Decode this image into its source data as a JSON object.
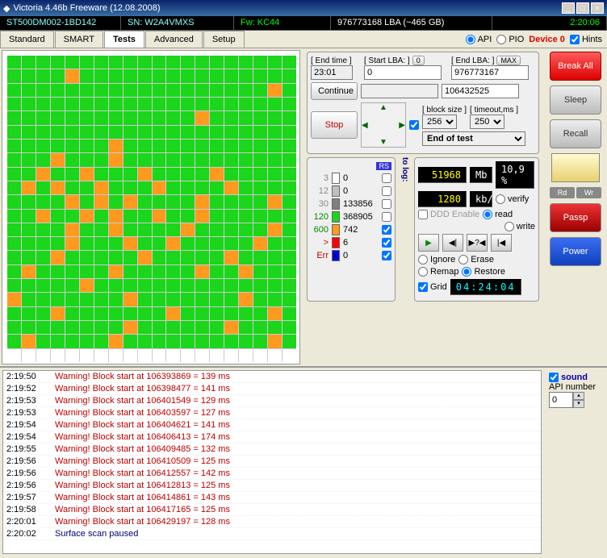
{
  "title": "Victoria 4.46b Freeware (12.08.2008)",
  "status": {
    "model": "ST500DM002-1BD142",
    "sn": "SN: W2A4VMXS",
    "fw": "Fw: KC44",
    "lba": "976773168 LBA (~465 GB)",
    "clock": "2:20:06"
  },
  "tabs": [
    "Standard",
    "SMART",
    "Tests",
    "Advanced",
    "Setup"
  ],
  "active_tab": "Tests",
  "api": {
    "api": "API",
    "pio": "PIO",
    "device": "Device 0",
    "hints": "Hints"
  },
  "scan": {
    "endtime_lbl": "[ End time ]",
    "endtime": "23:01",
    "startlba_lbl": "[ Start LBA: ]",
    "start_btn": "0",
    "startlba": "0",
    "endlba_lbl": "[ End LBA: ]",
    "max_btn": "MAX",
    "endlba": "976773167",
    "current": "106432525",
    "continue": "Continue",
    "stop": "Stop",
    "blocksize_lbl": "[ block size ]",
    "blocksize": "256",
    "timeout_lbl": "[ timeout,ms ]",
    "timeout": "250",
    "endtest": "End of test"
  },
  "legend": [
    {
      "c": "#ffffff",
      "t": "3",
      "v": "0"
    },
    {
      "c": "#c0c0c0",
      "t": "12",
      "v": "0"
    },
    {
      "c": "#808080",
      "t": "30",
      "v": "133856"
    },
    {
      "c": "#1bd61b",
      "t": "120",
      "v": "368905"
    },
    {
      "c": "#ff9a1f",
      "t": "600",
      "v": "742"
    },
    {
      "c": "#ff0000",
      "t": ">",
      "v": "6"
    },
    {
      "c": "#0000ff",
      "t": "Err",
      "v": "0",
      "x": "x"
    }
  ],
  "rs": "RS",
  "tolog": "to log:",
  "stats": {
    "num": "51968",
    "unit": "Mb",
    "pct": "10,9 %",
    "speed": "1280",
    "sunit": "kb/s",
    "ddd": "DDD Enable",
    "verify": "verify",
    "read": "read",
    "write": "write"
  },
  "play": {
    "play": "▶",
    "back": "◀|",
    "seek": "▶?◀",
    "end": "|◀"
  },
  "modes": {
    "ignore": "Ignore",
    "erase": "Erase",
    "remap": "Remap",
    "restore": "Restore"
  },
  "grid": "Grid",
  "timer": "04:24:04",
  "right": {
    "break": "Break All",
    "sleep": "Sleep",
    "recall": "Recall",
    "rd": "Rd",
    "wr": "Wr",
    "passp": "Passp",
    "power": "Power"
  },
  "sound": "sound",
  "apinumber": "API number",
  "apival": "0",
  "log": [
    {
      "t": "2:19:50",
      "m": "Warning! Block start at 106393869 = 139 ms"
    },
    {
      "t": "2:19:52",
      "m": "Warning! Block start at 106398477 = 141 ms"
    },
    {
      "t": "2:19:53",
      "m": "Warning! Block start at 106401549 = 129 ms"
    },
    {
      "t": "2:19:53",
      "m": "Warning! Block start at 106403597 = 127 ms"
    },
    {
      "t": "2:19:54",
      "m": "Warning! Block start at 106404621 = 141 ms"
    },
    {
      "t": "2:19:54",
      "m": "Warning! Block start at 106406413 = 174 ms"
    },
    {
      "t": "2:19:55",
      "m": "Warning! Block start at 106409485 = 132 ms"
    },
    {
      "t": "2:19:56",
      "m": "Warning! Block start at 106410509 = 125 ms"
    },
    {
      "t": "2:19:56",
      "m": "Warning! Block start at 106412557 = 142 ms"
    },
    {
      "t": "2:19:56",
      "m": "Warning! Block start at 106412813 = 125 ms"
    },
    {
      "t": "2:19:57",
      "m": "Warning! Block start at 106414861 = 143 ms"
    },
    {
      "t": "2:19:58",
      "m": "Warning! Block start at 106417165 = 125 ms"
    },
    {
      "t": "2:20:01",
      "m": "Warning! Block start at 106429197 = 128 ms"
    },
    {
      "t": "2:20:02",
      "m": "Surface scan paused",
      "ok": true
    }
  ],
  "map_orange": [
    24,
    58,
    93,
    127,
    143,
    147,
    162,
    165,
    169,
    174,
    181,
    183,
    186,
    190,
    195,
    204,
    206,
    208,
    213,
    218,
    222,
    225,
    227,
    230,
    233,
    244,
    247,
    252,
    258,
    264,
    268,
    271,
    277,
    283,
    289,
    295,
    301,
    307,
    313,
    316,
    325,
    340,
    348,
    356,
    363,
    371,
    378,
    388,
    395,
    401,
    407,
    418
  ]
}
